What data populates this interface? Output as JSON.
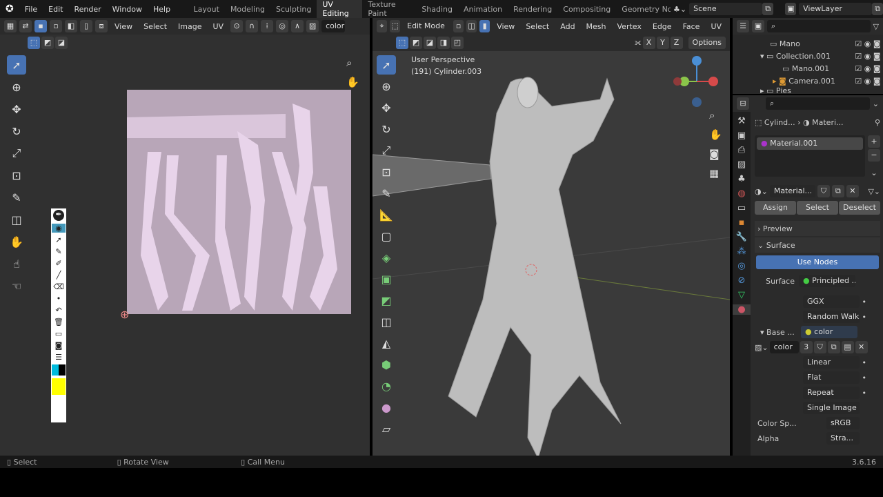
{
  "topbar": {
    "menus": [
      "File",
      "Edit",
      "Render",
      "Window",
      "Help"
    ],
    "workspaces": [
      "Layout",
      "Modeling",
      "Sculpting",
      "UV Editing",
      "Texture Paint",
      "Shading",
      "Animation",
      "Rendering",
      "Compositing",
      "Geometry Nodes"
    ],
    "active_workspace": "UV Editing",
    "scene": "Scene",
    "view_layer": "ViewLayer"
  },
  "uv_editor": {
    "menus": [
      "View",
      "Select",
      "Image",
      "UV"
    ],
    "image_name": "color"
  },
  "viewport": {
    "mode": "Edit Mode",
    "menus": [
      "View",
      "Select",
      "Add",
      "Mesh",
      "Vertex",
      "Edge",
      "Face",
      "UV"
    ],
    "overlay_line1": "User Perspective",
    "overlay_line2": "(191) Cylinder.003",
    "axes": [
      "X",
      "Y",
      "Z"
    ],
    "options": "Options"
  },
  "outliner": {
    "items": [
      {
        "label": "Mano",
        "indent": 1
      },
      {
        "label": "Collection.001",
        "indent": 1
      },
      {
        "label": "Mano.001",
        "indent": 2
      },
      {
        "label": "Camera.001",
        "indent": 2
      },
      {
        "label": "Pies",
        "indent": 1
      }
    ]
  },
  "properties": {
    "breadcrumb_object": "Cylind...",
    "breadcrumb_material": "Materi...",
    "slot": "Material.001",
    "material_name": "Material...",
    "assign": "Assign",
    "select": "Select",
    "deselect": "Deselect",
    "preview": "Preview",
    "surface_panel": "Surface",
    "use_nodes": "Use Nodes",
    "surface_label": "Surface",
    "surface_value": "Principled ...",
    "distribution": "GGX",
    "subsurface": "Random Walk",
    "base_label": "Base ...",
    "base_value": "color",
    "image": "color",
    "users": "3",
    "interpolation": "Linear",
    "projection": "Flat",
    "extension": "Repeat",
    "source": "Single Image",
    "colorspace_label": "Color Sp...",
    "colorspace": "sRGB",
    "alpha_label": "Alpha",
    "alpha": "Stra..."
  },
  "status": {
    "select": "Select",
    "rotate": "Rotate View",
    "call_menu": "Call Menu",
    "version": "3.6.16"
  },
  "colors": {
    "accent": "#4772b3",
    "uv_bg": "#b8a6b8",
    "uv_islands": "#e8d4ea"
  }
}
